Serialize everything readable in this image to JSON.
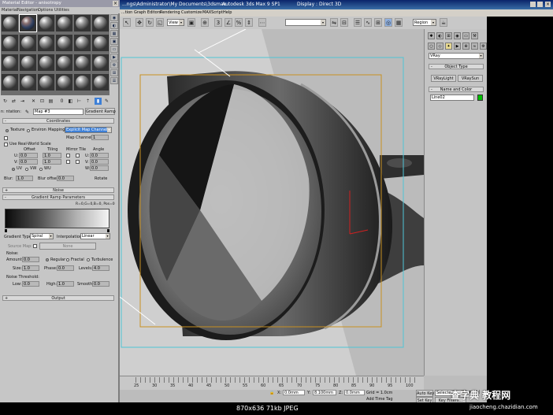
{
  "mat_editor": {
    "title": "Material Editor - anisotropy",
    "menu": [
      "Material",
      "Navigation",
      "Options",
      "Utilities"
    ],
    "map_label": "n: ntation:",
    "map_name": "Map #3",
    "map_type_button": "Gradient Ramp",
    "coordinates_rollout": "Coordinates",
    "texture_label": "Texture",
    "environ_label": "Environ",
    "mapping_label": "Mapping:",
    "mapping_value": "Explicit Map Channel",
    "map_channel_label": "Map Channel:",
    "map_channel_value": "1",
    "real_world_label": "Use Real-World Scale",
    "offset_label": "Offset",
    "tiling_label": "Tiling",
    "mirror_tile_label": "Mirror Tile",
    "angle_label": "Angle",
    "u_label": "U:",
    "v_label": "V:",
    "w_label": "W:",
    "offset_u": "0.0",
    "offset_v": "0.0",
    "tiling_u": "1.0",
    "tiling_v": "1.0",
    "angle_u": "0.0",
    "angle_v": "0.0",
    "angle_w": "0.0",
    "uv_label": "UV",
    "vw_label": "VW",
    "wu_label": "WU",
    "blur_label": "Blur:",
    "blur_value": "1.0",
    "blur_offset_label": "Blur offset:",
    "blur_offset_value": "0.0",
    "rotate_button": "Rotate",
    "noise_rollout": "Noise",
    "gradient_ramp_rollout": "Gradient Ramp Parameters",
    "ramp_readout": "R=0,G=0,B=0, Pos=0",
    "gradient_type_label": "Gradient Type:",
    "gradient_type_value": "Spiral",
    "interpolation_label": "Interpolation:",
    "interpolation_value": "Linear",
    "source_map_label": "Source Map:",
    "source_map_button": "None",
    "noise_group": "Noise:",
    "amount_label": "Amount:",
    "amount_value": "0.0",
    "regular_label": "Regular",
    "fractal_label": "Fractal",
    "turbulence_label": "Turbulence",
    "size_label": "Size:",
    "size_value": "1.0",
    "phase_label": "Phase:",
    "phase_value": "0.0",
    "levels_label": "Levels:",
    "levels_value": "4.0",
    "noise_threshold_label": "Noise Threshold:",
    "low_label": "Low:",
    "low_value": "0.0",
    "high_label": "High:",
    "high_value": "1.0",
    "smooth_label": "Smooth:",
    "smooth_value": "0.0",
    "output_rollout": "Output"
  },
  "max_window": {
    "title_path": "...ngs\\Administrator\\My Documents\\3dsmax",
    "title_app": "Autodesk 3ds Max 9 SP1",
    "title_display": "Display : Direct 3D",
    "menu": [
      "...tion",
      "Graph Editors",
      "Rendering",
      "Customize",
      "MAXScript",
      "Help"
    ],
    "view_dropdown": "View",
    "region_dropdown": "Region"
  },
  "command_panel": {
    "renderer_dropdown": "VRay",
    "object_type_rollout": "Object Type",
    "vray_light_button": "VRayLight",
    "vray_sun_button": "VRaySun",
    "name_color_rollout": "Name and Color",
    "object_name": "Line02",
    "object_color": "#00c000"
  },
  "timeline": {
    "ticks": [
      "25",
      "30",
      "35",
      "40",
      "45",
      "50",
      "55",
      "60",
      "65",
      "70",
      "75",
      "80",
      "85",
      "90",
      "95",
      "100"
    ]
  },
  "status": {
    "x_value": "0.0mm",
    "y_value": "8.100mm",
    "z_value": "0.0mm",
    "grid_label": "Grid = 1.0cm",
    "add_time_tag": "Add Time Tag",
    "auto_key": "Auto Key",
    "selected_dropdown": "Selected",
    "set_key": "Set Key",
    "key_filters": "Key Filters..."
  },
  "bottom_bar": {
    "image_info": "870x636  71kb  JPEG",
    "watermark_cn": "查字典 教程网",
    "watermark_url": "jiaocheng.chazidian.com"
  },
  "colors": {
    "titlebar": "#0a246a",
    "highlight": "#3d7fd6",
    "safe_frame_cyan": "#4fc4d6",
    "safe_frame_orange": "#c89020"
  }
}
